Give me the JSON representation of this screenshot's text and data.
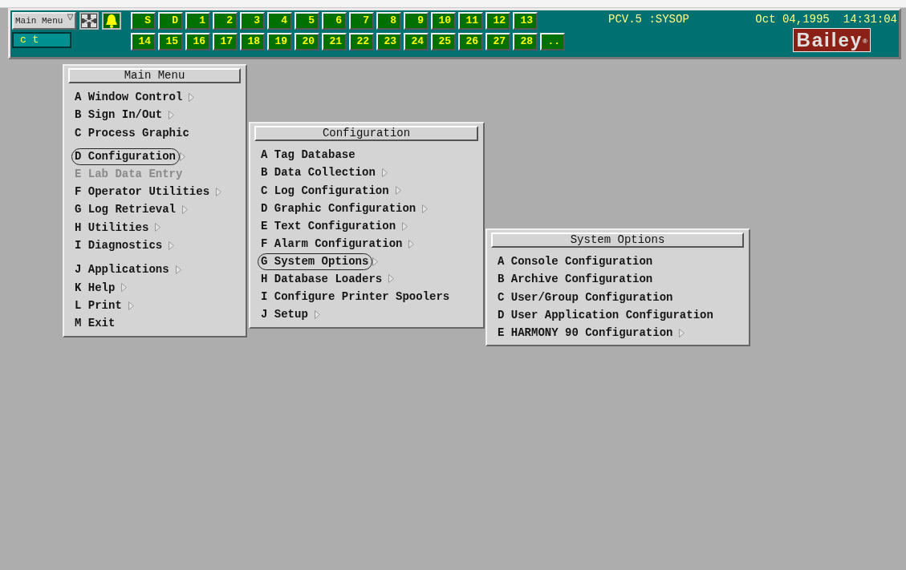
{
  "toolbar": {
    "menu_select": "Main Menu",
    "command_field": "c t",
    "display_buttons_row_1": [
      "S",
      "D",
      "1",
      "2",
      "3",
      "4",
      "5",
      "6",
      "7",
      "8",
      "9",
      "10",
      "11",
      "12",
      "13"
    ],
    "display_buttons_row_2": [
      "14",
      "15",
      "16",
      "17",
      "18",
      "19",
      "20",
      "21",
      "22",
      "23",
      "24",
      "25",
      "26",
      "27",
      "28",
      ".."
    ],
    "station": "PCV.5 :SYSOP",
    "date": "Oct 04,1995",
    "time": "14:31:04",
    "logo": {
      "text": "Bailey",
      "mark": "®"
    }
  },
  "menus": [
    {
      "title": "Main Menu",
      "groups": [
        [
          {
            "label": "A Window Control",
            "submenu": true,
            "selected": false,
            "disabled": false
          },
          {
            "label": "B Sign In/Out",
            "submenu": true,
            "selected": false,
            "disabled": false
          },
          {
            "label": "C Process Graphic",
            "submenu": false,
            "selected": false,
            "disabled": false
          }
        ],
        [
          {
            "label": "D Configuration",
            "submenu": true,
            "selected": true,
            "disabled": false
          },
          {
            "label": "E Lab Data Entry",
            "submenu": false,
            "selected": false,
            "disabled": true
          },
          {
            "label": "F Operator Utilities",
            "submenu": true,
            "selected": false,
            "disabled": false
          },
          {
            "label": "G Log Retrieval",
            "submenu": true,
            "selected": false,
            "disabled": false
          },
          {
            "label": "H Utilities",
            "submenu": true,
            "selected": false,
            "disabled": false
          },
          {
            "label": "I Diagnostics",
            "submenu": true,
            "selected": false,
            "disabled": false
          }
        ],
        [
          {
            "label": "J Applications",
            "submenu": true,
            "selected": false,
            "disabled": false
          },
          {
            "label": "K Help",
            "submenu": true,
            "selected": false,
            "disabled": false
          },
          {
            "label": "L Print",
            "submenu": true,
            "selected": false,
            "disabled": false
          },
          {
            "label": "M Exit",
            "submenu": false,
            "selected": false,
            "disabled": false
          }
        ]
      ]
    },
    {
      "title": "Configuration",
      "groups": [
        [
          {
            "label": "A Tag Database",
            "submenu": false,
            "selected": false,
            "disabled": false
          },
          {
            "label": "B Data Collection",
            "submenu": true,
            "selected": false,
            "disabled": false
          },
          {
            "label": "C Log Configuration",
            "submenu": true,
            "selected": false,
            "disabled": false
          },
          {
            "label": "D Graphic Configuration",
            "submenu": true,
            "selected": false,
            "disabled": false
          },
          {
            "label": "E Text Configuration",
            "submenu": true,
            "selected": false,
            "disabled": false
          },
          {
            "label": "F Alarm Configuration",
            "submenu": true,
            "selected": false,
            "disabled": false
          },
          {
            "label": "G System Options",
            "submenu": true,
            "selected": true,
            "disabled": false
          },
          {
            "label": "H Database Loaders",
            "submenu": true,
            "selected": false,
            "disabled": false
          },
          {
            "label": "I Configure Printer Spoolers",
            "submenu": false,
            "selected": false,
            "disabled": false
          },
          {
            "label": "J Setup",
            "submenu": true,
            "selected": false,
            "disabled": false
          }
        ]
      ]
    },
    {
      "title": "System Options",
      "groups": [
        [
          {
            "label": "A Console Configuration",
            "submenu": false,
            "selected": false,
            "disabled": false
          },
          {
            "label": "B Archive Configuration",
            "submenu": false,
            "selected": false,
            "disabled": false
          },
          {
            "label": "C User/Group Configuration",
            "submenu": false,
            "selected": false,
            "disabled": false
          },
          {
            "label": "D User Application Configuration",
            "submenu": false,
            "selected": false,
            "disabled": false
          },
          {
            "label": "E HARMONY 90 Configuration",
            "submenu": true,
            "selected": false,
            "disabled": false
          }
        ]
      ]
    }
  ]
}
